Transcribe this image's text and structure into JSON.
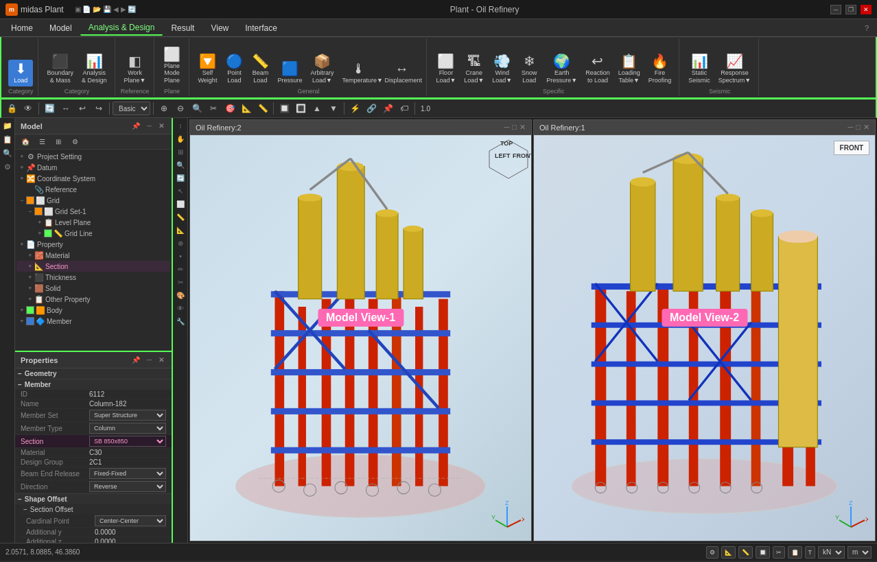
{
  "titlebar": {
    "app_name": "midas Plant",
    "title": "Plant - Oil Refinery",
    "minimize": "─",
    "maximize": "□",
    "close": "✕",
    "restore": "❐"
  },
  "menubar": {
    "items": [
      {
        "id": "home",
        "label": "Home"
      },
      {
        "id": "model",
        "label": "Model"
      },
      {
        "id": "analysis-design",
        "label": "Analysis & Design"
      },
      {
        "id": "result",
        "label": "Result"
      },
      {
        "id": "view",
        "label": "View"
      },
      {
        "id": "interface",
        "label": "Interface"
      }
    ],
    "active": "Analysis & Design",
    "help": "?"
  },
  "ribbon": {
    "groups": [
      {
        "id": "category",
        "label": "Category",
        "buttons": [
          {
            "id": "load",
            "icon": "⬇",
            "label": "Load",
            "active": true
          }
        ]
      },
      {
        "id": "category2",
        "label": "Category",
        "buttons": [
          {
            "id": "boundary-mass",
            "icon": "⬛",
            "label": "Boundary\n& Mass"
          },
          {
            "id": "analysis-design",
            "icon": "📊",
            "label": "Analysis\n& Design"
          }
        ]
      },
      {
        "id": "reference",
        "label": "Reference",
        "buttons": [
          {
            "id": "work-plane",
            "icon": "◧",
            "label": "Work\nPlane▼"
          }
        ]
      },
      {
        "id": "plane",
        "label": "Plane",
        "buttons": [
          {
            "id": "plane-mode",
            "icon": "⬜",
            "label": "Plane\nMode\nPlane"
          }
        ]
      },
      {
        "id": "general",
        "label": "General",
        "buttons": [
          {
            "id": "self-weight",
            "icon": "🔽",
            "label": "Self\nWeight"
          },
          {
            "id": "point-load",
            "icon": "🔵",
            "label": "Point\nLoad"
          },
          {
            "id": "beam-load",
            "icon": "📏",
            "label": "Beam\nLoad"
          },
          {
            "id": "pressure",
            "icon": "🟦",
            "label": "Pressure"
          },
          {
            "id": "arbitrary-load",
            "icon": "📦",
            "label": "Arbitrary\nLoad▼"
          },
          {
            "id": "temperature",
            "icon": "🌡",
            "label": "Temperature▼"
          },
          {
            "id": "displacement",
            "icon": "↔",
            "label": "Displacement"
          }
        ]
      },
      {
        "id": "specific",
        "label": "Specific",
        "buttons": [
          {
            "id": "floor-load",
            "icon": "⬜",
            "label": "Floor\nLoad▼"
          },
          {
            "id": "crane-load",
            "icon": "🏗",
            "label": "Crane\nLoad▼"
          },
          {
            "id": "wind-load",
            "icon": "💨",
            "label": "Wind\nLoad▼"
          },
          {
            "id": "snow-load",
            "icon": "❄",
            "label": "Snow\nLoad"
          },
          {
            "id": "earth-pressure",
            "icon": "🌍",
            "label": "Earth\nPressure▼"
          },
          {
            "id": "reaction-to-load",
            "icon": "↩",
            "label": "Reaction\nto Load"
          },
          {
            "id": "loading-table",
            "icon": "📋",
            "label": "Loading\nTable▼"
          },
          {
            "id": "fire-proofing",
            "icon": "🔥",
            "label": "Fire\nProofing"
          }
        ]
      },
      {
        "id": "seismic",
        "label": "Seismic",
        "buttons": [
          {
            "id": "static-seismic",
            "icon": "📊",
            "label": "Static\nSeismic"
          },
          {
            "id": "response-spectrum",
            "icon": "📈",
            "label": "Response\nSpectrum▼"
          }
        ]
      }
    ]
  },
  "toolbar2": {
    "dropdown_value": "Basic",
    "buttons": [
      "🔒",
      "👁",
      "🔄",
      "🔄",
      "⬅",
      "→",
      "⚙",
      "🔧",
      "✂",
      "↩",
      "↪",
      "⊕",
      "⊖",
      "⊕",
      "⊖",
      "⚡",
      "🔗",
      "📐",
      "📏",
      "🔲",
      "🔳",
      "▲",
      "▼",
      "◀",
      "▶",
      "🎯",
      "📌",
      "📍",
      "🏷",
      "🔑",
      "⚙"
    ]
  },
  "left_sidebar_tabs": {
    "icons": [
      "📁",
      "📋",
      "🔍",
      "⚙"
    ]
  },
  "icon_toolbar": {
    "icons": [
      "↕",
      "↔",
      "🔄",
      "🖱",
      "✋",
      "🔍",
      "🔎",
      "📐",
      "📏",
      "🎯",
      "✏",
      "✂",
      "📋",
      "🗑",
      "↩",
      "↪"
    ]
  },
  "model_panel": {
    "title": "Model",
    "items": [
      {
        "id": "project-setting",
        "label": "Project Setting",
        "indent": 1,
        "icon": "⚙",
        "expand": "+"
      },
      {
        "id": "datum",
        "label": "Datum",
        "indent": 1,
        "icon": "📌",
        "expand": "+"
      },
      {
        "id": "coordinate-system",
        "label": "Coordinate System",
        "indent": 1,
        "icon": "🔀",
        "expand": "+"
      },
      {
        "id": "reference",
        "label": "Reference",
        "indent": 2,
        "icon": "📎",
        "expand": ""
      },
      {
        "id": "grid",
        "label": "Grid",
        "indent": 1,
        "icon": "⬜",
        "expand": "-",
        "check": true
      },
      {
        "id": "grid-set-1",
        "label": "Grid Set-1",
        "indent": 2,
        "icon": "⬜",
        "expand": "-",
        "check": true
      },
      {
        "id": "level-plane",
        "label": "Level Plane",
        "indent": 3,
        "icon": "📋",
        "expand": "+"
      },
      {
        "id": "grid-line",
        "label": "Grid Line",
        "indent": 3,
        "icon": "📏",
        "expand": "+",
        "check": true
      },
      {
        "id": "property",
        "label": "Property",
        "indent": 1,
        "icon": "📄",
        "expand": "+"
      },
      {
        "id": "material",
        "label": "Material",
        "indent": 2,
        "icon": "🧱",
        "expand": "+"
      },
      {
        "id": "section",
        "label": "Section",
        "indent": 2,
        "icon": "📐",
        "expand": "+",
        "highlight": true
      },
      {
        "id": "thickness",
        "label": "Thickness",
        "indent": 2,
        "icon": "⬛",
        "expand": "+"
      },
      {
        "id": "solid",
        "label": "Solid",
        "indent": 2,
        "icon": "🟫",
        "expand": "+"
      },
      {
        "id": "other-property",
        "label": "Other Property",
        "indent": 2,
        "icon": "📋",
        "expand": "+"
      },
      {
        "id": "body",
        "label": "Body",
        "indent": 1,
        "icon": "🟧",
        "expand": "+",
        "check": true
      },
      {
        "id": "member",
        "label": "Member",
        "indent": 1,
        "icon": "🔷",
        "expand": "+",
        "check": true
      }
    ]
  },
  "properties_panel": {
    "title": "Properties",
    "sections": [
      {
        "id": "geometry",
        "label": "Geometry",
        "expanded": true
      },
      {
        "id": "member",
        "label": "Member",
        "expanded": true,
        "rows": [
          {
            "label": "ID",
            "value": "6112",
            "type": "text"
          },
          {
            "label": "Name",
            "value": "Column-182",
            "type": "text"
          },
          {
            "label": "Member Set",
            "value": "Super Structure",
            "type": "select"
          },
          {
            "label": "Member Type",
            "value": "Column",
            "type": "select"
          },
          {
            "label": "Section",
            "value": "SB 850x850",
            "type": "select",
            "highlight": true
          },
          {
            "label": "Material",
            "value": "C30",
            "type": "text"
          },
          {
            "label": "Design Group",
            "value": "2C1",
            "type": "text"
          },
          {
            "label": "Beam End Release",
            "value": "Fixed-Fixed",
            "type": "select"
          },
          {
            "label": "Direction",
            "value": "Reverse",
            "type": "select"
          }
        ]
      },
      {
        "id": "shape-offset",
        "label": "Shape Offset",
        "expanded": true,
        "subsections": [
          {
            "id": "section-offset",
            "label": "Section Offset",
            "rows": [
              {
                "label": "Cardinal Point",
                "value": "Center-Center",
                "type": "select"
              },
              {
                "label": "Additional y",
                "value": "0.0000",
                "type": "text"
              },
              {
                "label": "Additional z",
                "value": "0.0000",
                "type": "text"
              }
            ]
          }
        ]
      }
    ]
  },
  "view_panels": [
    {
      "id": "view1",
      "title": "Oil Refinery:2",
      "label": "Model View-1",
      "orientation": "TOP-LEFT-FRONT"
    },
    {
      "id": "view2",
      "title": "Oil Refinery:1",
      "label": "Model View-2",
      "orientation": "FRONT"
    }
  ],
  "statusbar": {
    "coordinates": "2.0571, 8.0885, 46.3860",
    "unit_force": "kN",
    "unit_length": "m",
    "buttons": [
      "⚙",
      "📐",
      "📏",
      "🔲",
      "✂",
      "📋",
      "T"
    ]
  }
}
